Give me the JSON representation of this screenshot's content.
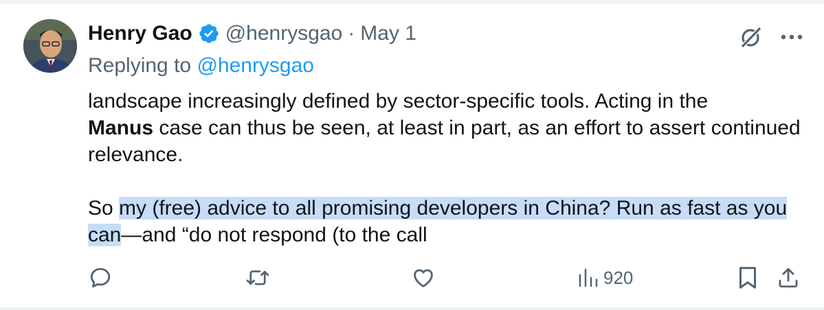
{
  "author": {
    "display_name": "Henry Gao",
    "handle": "@henrysgao",
    "separator": "·",
    "date": "May 1",
    "verified": true
  },
  "reply_context": {
    "prefix": "Replying to ",
    "mention": "@henrysgao"
  },
  "body": {
    "p1_part1": "landscape increasingly defined by sector-specific tools. Acting in the",
    "p1_bold": "Manus",
    "p1_part2": " case can thus be seen, at least in part, as an effort to assert continued relevance.",
    "p2_plain_start": "So ",
    "p2_highlighted": "my (free) advice to all promising developers in China? Run as fast as you can",
    "p2_rest": "—and “do not respond (to the call"
  },
  "stats": {
    "views": "920"
  },
  "colors": {
    "text": "#0f1419",
    "secondary": "#536471",
    "accent": "#1d9bf0",
    "highlight": "#c7dcf7"
  },
  "icons": {
    "verified": "verified-badge-icon",
    "grok": "grok-icon",
    "more": "more-icon",
    "reply": "reply-icon",
    "retweet": "retweet-icon",
    "like": "heart-icon",
    "views": "views-icon",
    "bookmark": "bookmark-icon",
    "share": "share-icon"
  }
}
